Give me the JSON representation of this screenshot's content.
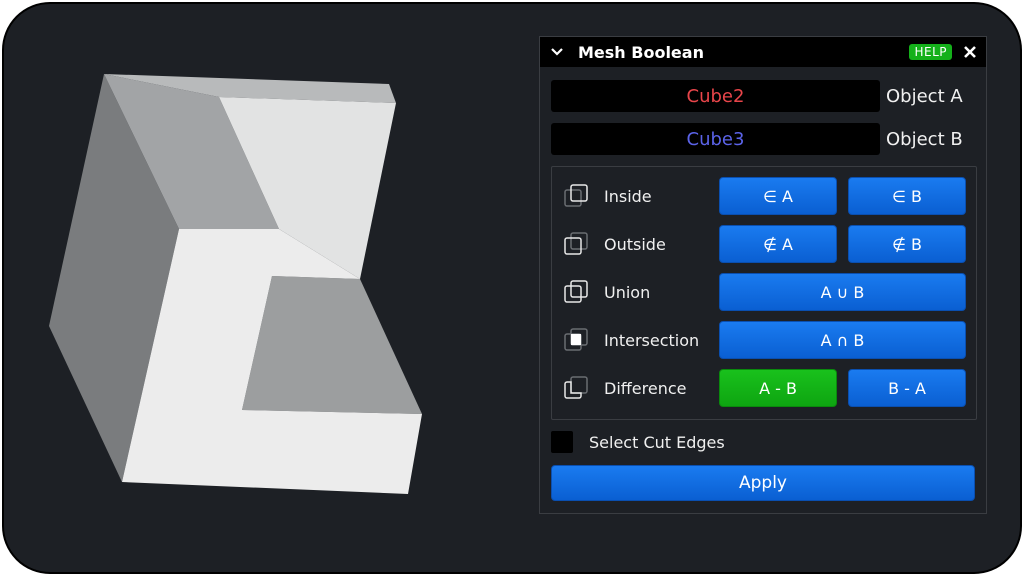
{
  "panel": {
    "title": "Mesh Boolean",
    "help_label": "HELP",
    "collapse_icon": "chevron-down-icon",
    "close_icon": "close-icon"
  },
  "objects": {
    "a": {
      "value": "Cube2",
      "label": "Object A",
      "color": "#e8454a"
    },
    "b": {
      "value": "Cube3",
      "label": "Object B",
      "color": "#5b63e8"
    }
  },
  "operations": [
    {
      "label": "Inside",
      "icon": "inside-icon",
      "buttons": [
        "∈ A",
        "∈ B"
      ]
    },
    {
      "label": "Outside",
      "icon": "outside-icon",
      "buttons": [
        "∉ A",
        "∉ B"
      ]
    },
    {
      "label": "Union",
      "icon": "union-icon",
      "buttons": [
        "A ∪ B"
      ]
    },
    {
      "label": "Intersection",
      "icon": "intersection-icon",
      "buttons": [
        "A ∩ B"
      ]
    },
    {
      "label": "Difference",
      "icon": "difference-icon",
      "buttons": [
        "A - B",
        "B - A"
      ]
    }
  ],
  "selected_operation": "A - B",
  "select_cut_edges": {
    "label": "Select Cut Edges",
    "checked": false
  },
  "apply_label": "Apply",
  "colors": {
    "background": "#1d2025",
    "button_blue": "#1a7bf0",
    "button_selected_green": "#14b01a"
  }
}
